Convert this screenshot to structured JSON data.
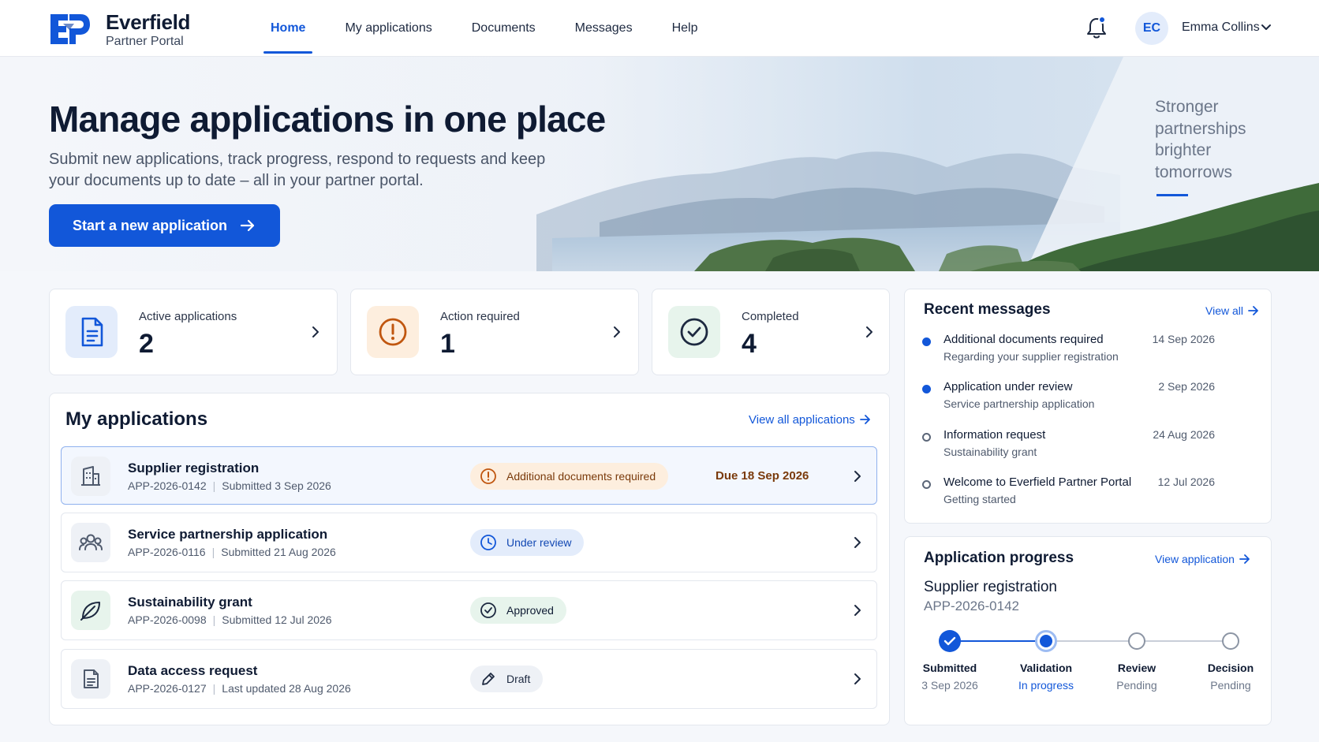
{
  "brand": {
    "name": "Everfield",
    "sub": "Partner Portal"
  },
  "nav": [
    {
      "label": "Home"
    },
    {
      "label": "My applications"
    },
    {
      "label": "Documents"
    },
    {
      "label": "Messages"
    },
    {
      "label": "Help"
    }
  ],
  "user": {
    "initials": "EC",
    "name": "Emma Collins",
    "has_notifications": true
  },
  "hero": {
    "title": "Manage applications in one place",
    "subtitle": "Submit new applications, track progress, respond to requests and keep your documents up to date – all in your partner portal.",
    "cta": "Start a new application",
    "tagline": "Stronger\npartnerships\nbrighter\ntomorrows"
  },
  "stats": [
    {
      "label": "Active applications",
      "value": "2",
      "icon": "document-icon"
    },
    {
      "label": "Action required",
      "value": "1",
      "icon": "alert-circle-icon"
    },
    {
      "label": "Completed",
      "value": "4",
      "icon": "check-circle-icon"
    }
  ],
  "applications": {
    "title": "My applications",
    "view_all": "View all applications",
    "rows": [
      {
        "title": "Supplier registration",
        "id": "APP-2026-0142",
        "date": "Submitted 3 Sep 2026",
        "status": "Additional documents required",
        "due": "Due 18 Sep 2026",
        "icon": "building-icon"
      },
      {
        "title": "Service partnership application",
        "id": "APP-2026-0116",
        "date": "Submitted 21 Aug 2026",
        "status": "Under review",
        "due": "",
        "icon": "people-icon"
      },
      {
        "title": "Sustainability grant",
        "id": "APP-2026-0098",
        "date": "Submitted 12 Jul 2026",
        "status": "Approved",
        "due": "",
        "icon": "leaf-icon"
      },
      {
        "title": "Data access request",
        "id": "APP-2026-0127",
        "date": "Last updated 28 Aug 2026",
        "status": "Draft",
        "due": "",
        "icon": "file-icon"
      }
    ]
  },
  "messages": {
    "title": "Recent messages",
    "view_all": "View all",
    "items": [
      {
        "title": "Additional documents required",
        "sub": "Regarding your supplier registration",
        "date": "14 Sep 2026",
        "unread": true
      },
      {
        "title": "Application under review",
        "sub": "Service partnership application",
        "date": "2 Sep 2026",
        "unread": true
      },
      {
        "title": "Information request",
        "sub": "Sustainability grant",
        "date": "24 Aug 2026",
        "unread": false
      },
      {
        "title": "Welcome to Everfield Partner Portal",
        "sub": "Getting started",
        "date": "12 Jul 2026",
        "unread": false
      }
    ]
  },
  "progress": {
    "title": "Application progress",
    "link": "View application",
    "name": "Supplier registration",
    "id": "APP-2026-0142",
    "steps": [
      {
        "label": "Submitted",
        "sub": "3 Sep 2026",
        "state": "done"
      },
      {
        "label": "Validation",
        "sub": "In progress",
        "state": "current"
      },
      {
        "label": "Review",
        "sub": "Pending",
        "state": "pending"
      },
      {
        "label": "Decision",
        "sub": "Pending",
        "state": "pending"
      }
    ]
  },
  "colors": {
    "accent": "#1257d9",
    "warning": "#c0560f",
    "success_bg": "#e7f4ec",
    "draft_bg": "#eef1f6"
  }
}
